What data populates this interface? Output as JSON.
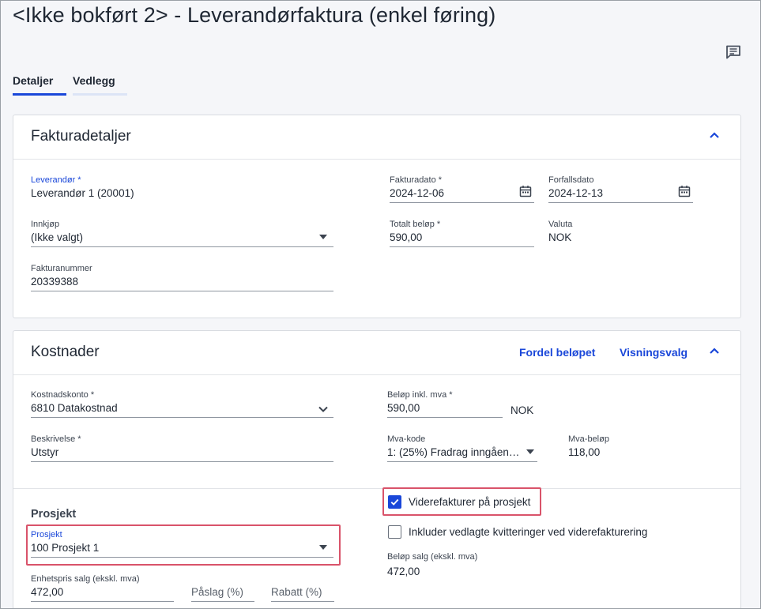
{
  "page": {
    "title": "<Ikke bokført 2> - Leverandørfaktura (enkel føring)"
  },
  "icons": {
    "comments": "comment-icon",
    "calendar": "calendar-icon",
    "dropdown": "caret-down-icon",
    "collapse": "chevron-up-icon",
    "select": "chevron-down-icon",
    "check": "check-icon"
  },
  "colors": {
    "accent": "#1a47d9",
    "highlight": "#d9536a",
    "text": "#1f2733"
  },
  "tabs": [
    {
      "label": "Detaljer",
      "active": true
    },
    {
      "label": "Vedlegg",
      "active": false
    }
  ],
  "invoice": {
    "title": "Fakturadetaljer",
    "supplier": {
      "label": "Leverandør *",
      "value": "Leverandør 1 (20001)"
    },
    "purchase": {
      "label": "Innkjøp",
      "value": "(Ikke valgt)"
    },
    "invoice_number": {
      "label": "Fakturanummer",
      "value": "20339388"
    },
    "invoice_date": {
      "label": "Fakturadato *",
      "value": "2024-12-06"
    },
    "due_date": {
      "label": "Forfallsdato",
      "value": "2024-12-13"
    },
    "total": {
      "label": "Totalt beløp *",
      "value": "590,00"
    },
    "currency": {
      "label": "Valuta",
      "value": "NOK"
    }
  },
  "costs": {
    "title": "Kostnader",
    "distribute_label": "Fordel beløpet",
    "view_options_label": "Visningsvalg",
    "account": {
      "label": "Kostnadskonto *",
      "value": "6810 Datakostnad"
    },
    "description": {
      "label": "Beskrivelse *",
      "value": "Utstyr"
    },
    "amount_incl": {
      "label": "Beløp inkl. mva *",
      "value": "590,00",
      "currency": "NOK"
    },
    "vat_code": {
      "label": "Mva-kode",
      "value": "1: (25%) Fradrag inngåen…"
    },
    "vat_amount": {
      "label": "Mva-beløp",
      "value": "118,00"
    }
  },
  "project": {
    "section_title": "Prosjekt",
    "project": {
      "label": "Prosjekt",
      "value": "100 Prosjekt 1"
    },
    "rebill": {
      "label": "Viderefakturer på prosjekt",
      "checked": true
    },
    "include_receipts": {
      "label": "Inkluder vedlagte kvitteringer ved viderefakturering",
      "checked": false
    },
    "sale_amount": {
      "label": "Beløp salg (ekskl. mva)",
      "value": "472,00"
    },
    "unit_price": {
      "label": "Enhetspris salg (ekskl. mva)",
      "value": "472,00"
    },
    "markup": {
      "label": "Påslag (%)"
    },
    "discount": {
      "label": "Rabatt (%)"
    }
  }
}
